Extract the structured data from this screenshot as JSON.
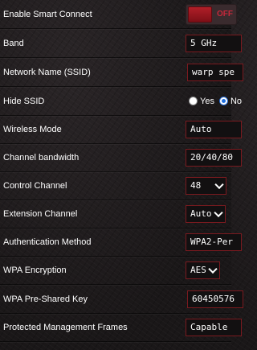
{
  "settings": {
    "smart_connect": {
      "label": "Enable Smart Connect",
      "toggle_text": "OFF",
      "enabled": false
    },
    "band": {
      "label": "Band",
      "value": "5 GHz"
    },
    "ssid": {
      "label": "Network Name (SSID)",
      "value": "warp spe"
    },
    "hide_ssid": {
      "label": "Hide SSID",
      "options": [
        "Yes",
        "No"
      ],
      "selected": "No"
    },
    "wireless_mode": {
      "label": "Wireless Mode",
      "value": "Auto"
    },
    "channel_bandwidth": {
      "label": "Channel bandwidth",
      "value": "20/40/80"
    },
    "control_channel": {
      "label": "Control Channel",
      "value": "48"
    },
    "extension_channel": {
      "label": "Extension Channel",
      "value": "Auto"
    },
    "auth_method": {
      "label": "Authentication Method",
      "value": "WPA2-Per"
    },
    "wpa_encryption": {
      "label": "WPA Encryption",
      "value": "AES"
    },
    "wpa_psk": {
      "label": "WPA Pre-Shared Key",
      "value": "60450576"
    },
    "pmf": {
      "label": "Protected Management Frames",
      "value": "Capable"
    }
  },
  "colors": {
    "accent": "#b11f28",
    "field_border": "#7a1a1f",
    "radio_selected": "#1e6fe0"
  },
  "icons": {
    "select_arrow": "chevron-down-icon"
  }
}
